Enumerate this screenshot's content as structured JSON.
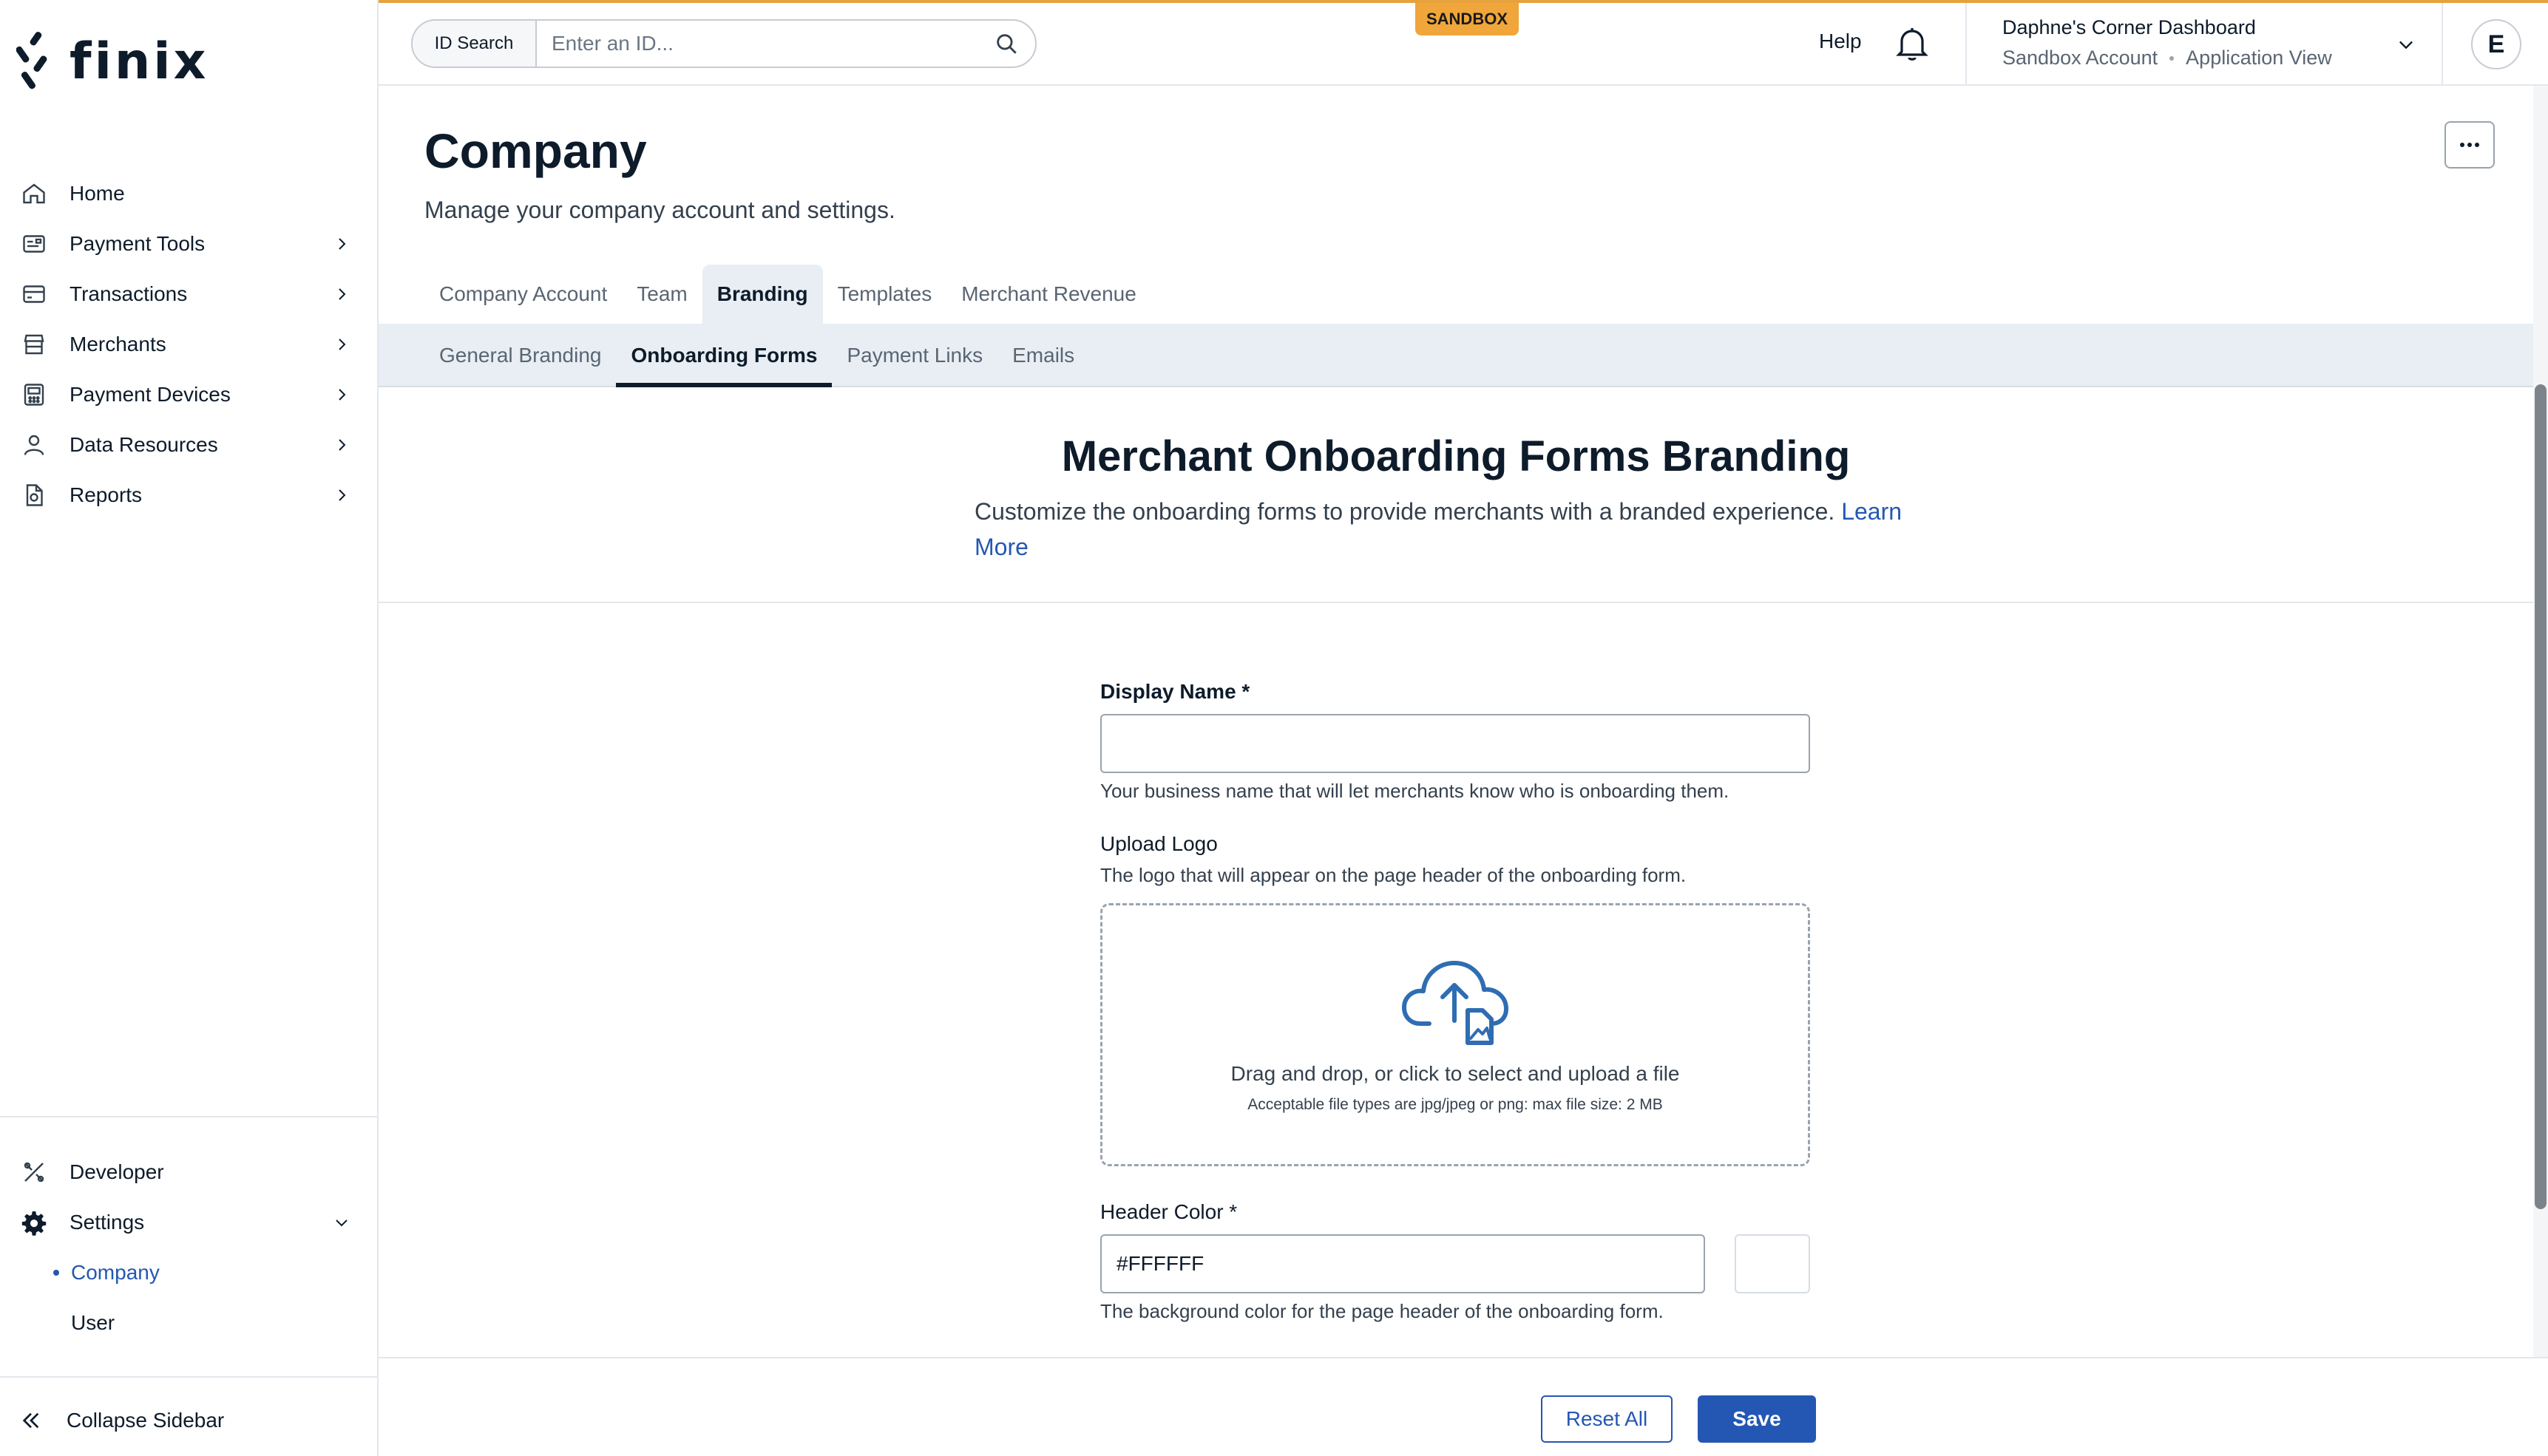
{
  "brand": {
    "name": "finix"
  },
  "sidebar": {
    "items": [
      {
        "label": "Home",
        "icon": "home-icon"
      },
      {
        "label": "Payment Tools",
        "icon": "payment-tools-icon"
      },
      {
        "label": "Transactions",
        "icon": "transactions-icon"
      },
      {
        "label": "Merchants",
        "icon": "merchants-icon"
      },
      {
        "label": "Payment Devices",
        "icon": "payment-devices-icon"
      },
      {
        "label": "Data Resources",
        "icon": "data-resources-icon"
      },
      {
        "label": "Reports",
        "icon": "reports-icon"
      }
    ],
    "developer": "Developer",
    "settings": "Settings",
    "settings_children": [
      "Company",
      "User"
    ],
    "collapse": "Collapse Sidebar"
  },
  "header": {
    "badge": "SANDBOX",
    "search_label": "ID Search",
    "search_placeholder": "Enter an ID...",
    "help": "Help",
    "dashboard_title": "Daphne's Corner Dashboard",
    "dashboard_account": "Sandbox Account",
    "dashboard_view": "Application View",
    "avatar_initial": "E"
  },
  "page": {
    "title": "Company",
    "subtitle": "Manage your company account and settings.",
    "tabs": [
      "Company Account",
      "Team",
      "Branding",
      "Templates",
      "Merchant Revenue"
    ],
    "active_tab": "Branding",
    "subtabs": [
      "General Branding",
      "Onboarding Forms",
      "Payment Links",
      "Emails"
    ],
    "active_subtab": "Onboarding Forms"
  },
  "section": {
    "title": "Merchant Onboarding Forms Branding",
    "description": "Customize the onboarding forms to provide merchants with a branded experience.",
    "learn_more": "Learn More"
  },
  "form": {
    "display_name": {
      "label": "Display Name *",
      "value": "",
      "helper": "Your business name that will let merchants know who is onboarding them."
    },
    "logo": {
      "label": "Upload Logo",
      "helper": "The logo that will appear on the page header of the onboarding form.",
      "drop_text": "Drag and drop, or click to select and upload a file",
      "file_types": "Acceptable file types are jpg/jpeg or png: max file size: 2 MB"
    },
    "header_color": {
      "label": "Header Color *",
      "value": "#FFFFFF",
      "helper": "The background color for the page header of the onboarding form."
    }
  },
  "footer": {
    "reset": "Reset All",
    "save": "Save"
  },
  "colors": {
    "accent": "#2457b3",
    "sandbox": "#f0a63a",
    "swatch": "#FFFFFF"
  }
}
